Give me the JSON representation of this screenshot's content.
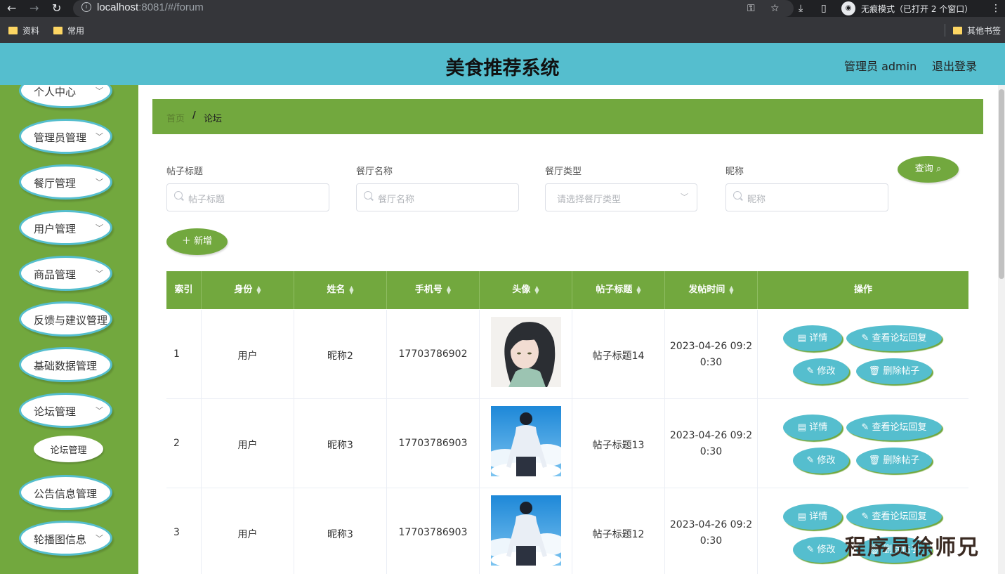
{
  "browser": {
    "url_host": "localhost",
    "url_rest": ":8081/#/forum",
    "incognito_label": "无痕模式（已打开 2 个窗口）",
    "bookmarks": [
      "资料",
      "常用"
    ],
    "other_bookmarks": "其他书签"
  },
  "header": {
    "title": "美食推荐系统",
    "user": "管理员 admin",
    "logout": "退出登录"
  },
  "sidebar": {
    "items": [
      {
        "label": "个人中心",
        "chevron": true
      },
      {
        "label": "管理员管理",
        "chevron": true
      },
      {
        "label": "餐厅管理",
        "chevron": true
      },
      {
        "label": "用户管理",
        "chevron": true
      },
      {
        "label": "商品管理",
        "chevron": true
      },
      {
        "label": "反馈与建议管理",
        "chevron": false
      },
      {
        "label": "基础数据管理",
        "chevron": false
      },
      {
        "label": "论坛管理",
        "chevron": true
      },
      {
        "label": "公告信息管理",
        "chevron": false
      },
      {
        "label": "轮播图信息",
        "chevron": true
      }
    ],
    "subitem": "论坛管理"
  },
  "breadcrumb": {
    "home": "首页",
    "separator": "/",
    "current": "论坛"
  },
  "filters": {
    "post_title_label": "帖子标题",
    "post_title_placeholder": "帖子标题",
    "restaurant_name_label": "餐厅名称",
    "restaurant_name_placeholder": "餐厅名称",
    "restaurant_type_label": "餐厅类型",
    "restaurant_type_placeholder": "请选择餐厅类型",
    "nickname_label": "昵称",
    "nickname_placeholder": "昵称",
    "query_button": "查询",
    "add_button": "新增"
  },
  "table": {
    "columns": [
      "索引",
      "身份",
      "姓名",
      "手机号",
      "头像",
      "帖子标题",
      "发帖时间",
      "操作"
    ],
    "rows": [
      {
        "index": "1",
        "identity": "用户",
        "name": "昵称2",
        "phone": "17703786902",
        "avatar": "girl-portrait",
        "title": "帖子标题14",
        "time_l1": "2023-04-26 09:2",
        "time_l2": "0:30"
      },
      {
        "index": "2",
        "identity": "用户",
        "name": "昵称3",
        "phone": "17703786903",
        "avatar": "boy-sky",
        "title": "帖子标题13",
        "time_l1": "2023-04-26 09:2",
        "time_l2": "0:30"
      },
      {
        "index": "3",
        "identity": "用户",
        "name": "昵称3",
        "phone": "17703786903",
        "avatar": "boy-sky",
        "title": "帖子标题12",
        "time_l1": "2023-04-26 09:2",
        "time_l2": "0:30"
      }
    ],
    "actions": {
      "detail": "详情",
      "view_replies": "查看论坛回复",
      "edit": "修改",
      "delete": "删除帖子"
    }
  },
  "watermark": "程序员徐师兄",
  "colors": {
    "header": "#55bece",
    "sidebar": "#72a83e",
    "accent_green": "#72a83e",
    "action_button": "#55bece"
  }
}
